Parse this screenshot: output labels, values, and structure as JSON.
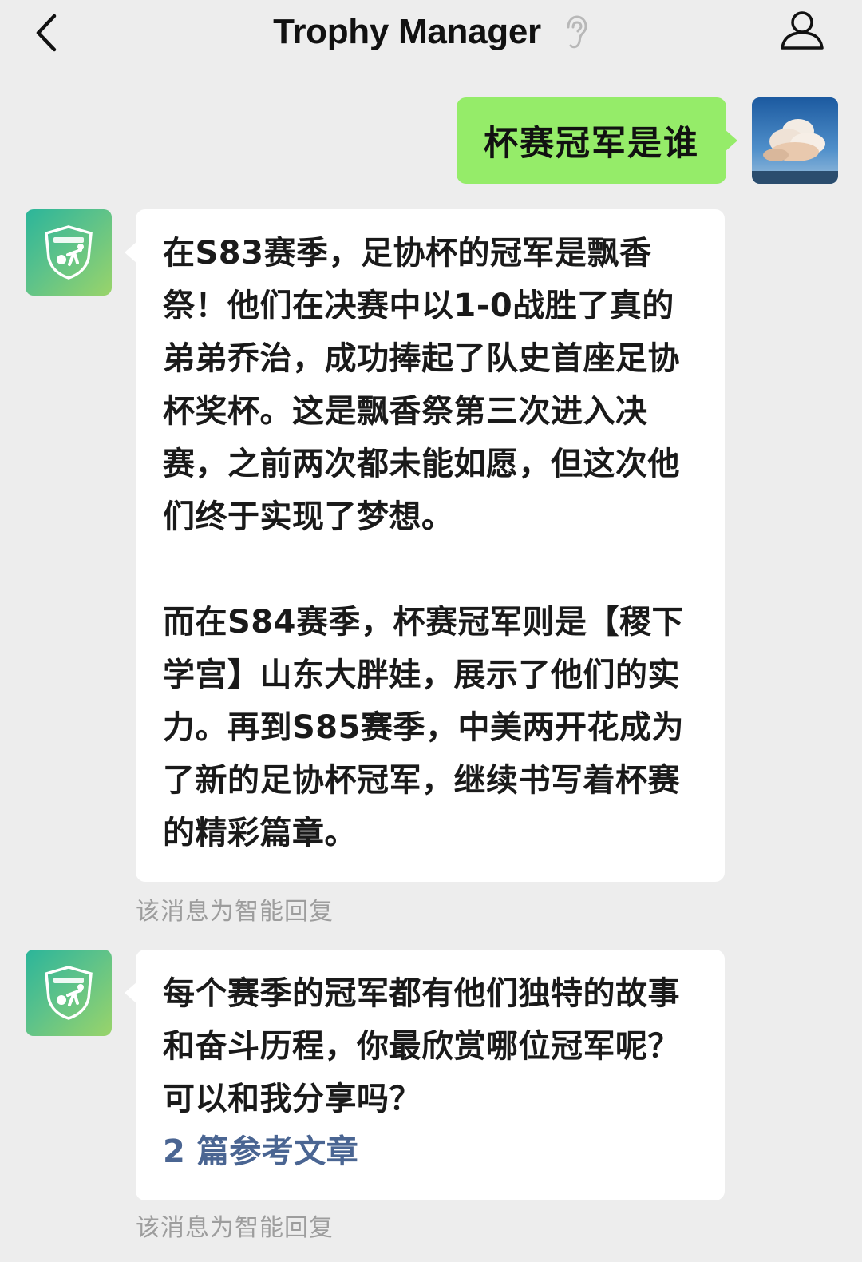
{
  "header": {
    "title": "Trophy Manager",
    "back_icon": "chevron-left-icon",
    "ear_icon": "ear-icon",
    "profile_icon": "person-icon"
  },
  "colors": {
    "background": "#ededed",
    "outgoing_bubble": "#95ec69",
    "incoming_bubble": "#ffffff",
    "link": "#4a6592",
    "hint_text": "#9d9d9d"
  },
  "messages": {
    "outgoing": {
      "text": "杯赛冠军是谁",
      "avatar_icon": "sky-cloud-avatar"
    },
    "reply1": {
      "avatar_icon": "trophy-manager-logo",
      "para1": "在S83赛季，足协杯的冠军是飘香祭！他们在决赛中以1-0战胜了真的弟弟乔治，成功捧起了队史首座足协杯奖杯。这是飘香祭第三次进入决赛，之前两次都未能如愿，但这次他们终于实现了梦想。",
      "para2": "而在S84赛季，杯赛冠军则是【稷下学宫】山东大胖娃，展示了他们的实力。再到S85赛季，中美两开花成为了新的足协杯冠军，继续书写着杯赛的精彩篇章。",
      "hint": "该消息为智能回复"
    },
    "reply2": {
      "avatar_icon": "trophy-manager-logo",
      "text": "每个赛季的冠军都有他们独特的故事和奋斗历程，你最欣赏哪位冠军呢？可以和我分享吗？",
      "link": "2 篇参考文章",
      "hint": "该消息为智能回复"
    }
  }
}
